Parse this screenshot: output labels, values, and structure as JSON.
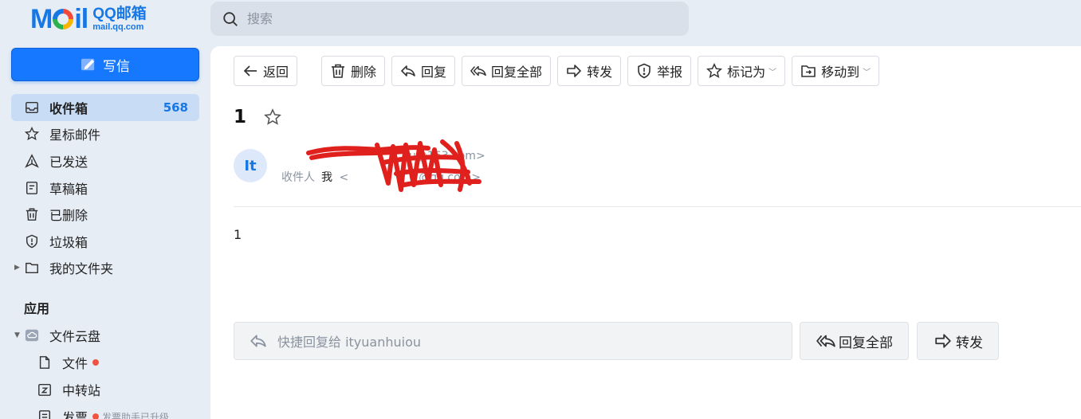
{
  "logo": {
    "mark_left": "M",
    "mark_right": "il",
    "title": "QQ邮箱",
    "domain": "mail.qq.com"
  },
  "search": {
    "placeholder": "搜索"
  },
  "sidebar": {
    "compose_label": "写信",
    "items": [
      {
        "label": "收件箱",
        "count": "568",
        "icon": "inbox-icon"
      },
      {
        "label": "星标邮件",
        "icon": "star-icon"
      },
      {
        "label": "已发送",
        "icon": "sent-icon"
      },
      {
        "label": "草稿箱",
        "icon": "draft-icon"
      },
      {
        "label": "已删除",
        "icon": "trash-icon"
      },
      {
        "label": "垃圾箱",
        "icon": "spam-shield-icon"
      },
      {
        "label": "我的文件夹",
        "icon": "folder-icon"
      }
    ],
    "apps_title": "应用",
    "apps": [
      {
        "label": "文件云盘",
        "icon": "cloud-drive-icon"
      },
      {
        "label": "文件",
        "icon": "file-icon"
      },
      {
        "label": "中转站",
        "icon": "transfer-station-icon"
      },
      {
        "label": "发票",
        "note": "发票助手已升级",
        "icon": "invoice-icon"
      }
    ]
  },
  "toolbar": {
    "back": "返回",
    "delete": "删除",
    "reply": "回复",
    "reply_all": "回复全部",
    "forward": "转发",
    "report": "举报",
    "mark_as": "标记为",
    "move_to": "移动到"
  },
  "mail": {
    "subject": "1",
    "avatar_initials": "It",
    "from_address_visible": "u@163.com>",
    "to_label": "收件人",
    "to_name": "我",
    "to_address_prefix": "<",
    "to_address_suffix": "@qq.com>",
    "body": "1"
  },
  "quick_reply": {
    "placeholder": "快捷回复给 ityuanhuiou",
    "reply_all": "回复全部",
    "forward": "转发"
  },
  "colors": {
    "accent": "#1677ff",
    "unread_dot": "#f0533f",
    "redaction": "#e0201c"
  }
}
